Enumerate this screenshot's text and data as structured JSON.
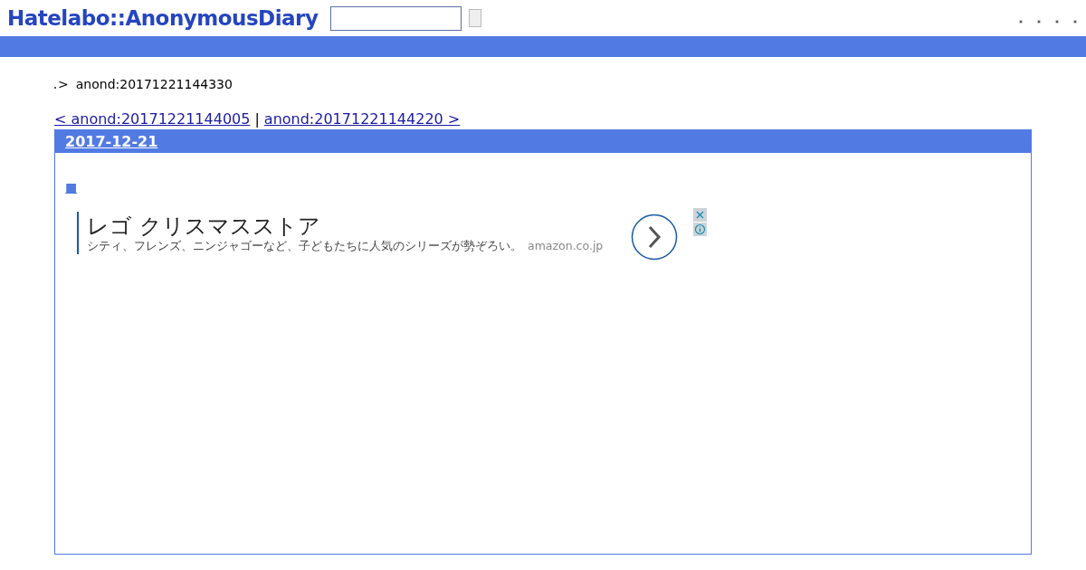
{
  "header": {
    "logo": "Hatelabo::AnonymousDiary"
  },
  "breadcrumb": {
    "separator": ">",
    "current": "anond:20171221144330"
  },
  "pager": {
    "prev": "< anond:20171221144005",
    "divider": "|",
    "next": "anond:20171221144220 >"
  },
  "day": {
    "date": "2017-12-21",
    "section_mark": "■",
    "ad": {
      "title": "レゴ クリスマスストア",
      "description": "シティ、フレンズ、ニンジャゴーなど、子どもたちに人気のシリーズが勢ぞろい。",
      "domain": "amazon.co.jp"
    }
  }
}
